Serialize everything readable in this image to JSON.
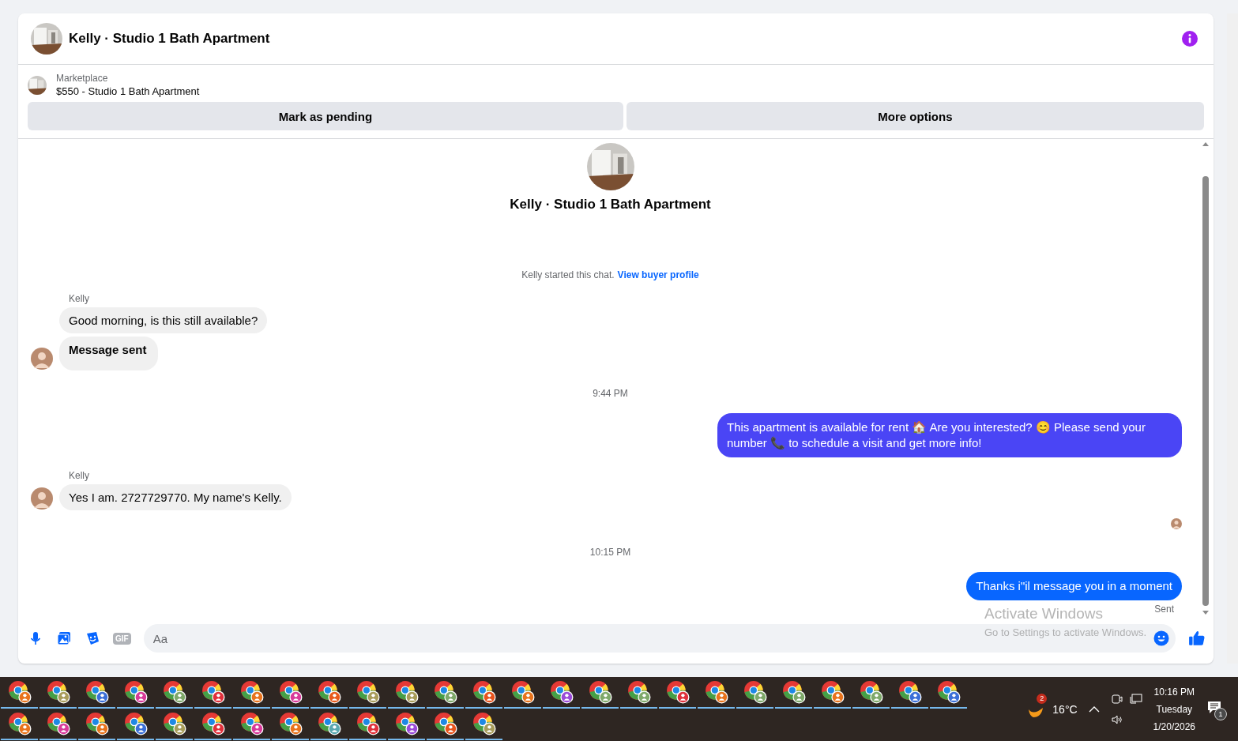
{
  "header": {
    "title": "Kelly · Studio 1 Bath Apartment"
  },
  "listing": {
    "source": "Marketplace",
    "title": "$550 - Studio 1 Bath Apartment"
  },
  "actions": [
    "Mark as pending",
    "More options"
  ],
  "intro": {
    "title": "Kelly · Studio 1 Bath Apartment",
    "started": "Kelly started this chat.",
    "link": "View buyer profile"
  },
  "thread": [
    {
      "kind": "incoming",
      "sender": "Kelly",
      "bubbles": [
        {
          "text": "Good morning, is this still available?",
          "bold": false
        },
        {
          "text": "Message sent",
          "bold": true
        }
      ]
    },
    {
      "kind": "timestamp",
      "text": "9:44 PM"
    },
    {
      "kind": "outgoing",
      "text": "This apartment is available for rent 🏠 Are you interested? 😊 Please send your number 📞 to schedule a visit and get more info!",
      "color": "#4a45f5"
    },
    {
      "kind": "incoming",
      "sender": "Kelly",
      "bubbles": [
        {
          "text": "Yes I am. 2727729770. My name's Kelly.",
          "bold": false
        }
      ]
    },
    {
      "kind": "seen"
    },
    {
      "kind": "timestamp",
      "text": "10:15 PM"
    },
    {
      "kind": "outgoing",
      "text": "Thanks i\"il message you in a moment",
      "color": "#0866ff",
      "status": "Sent"
    }
  ],
  "composer": {
    "gif_label": "GIF",
    "placeholder": "Aa"
  },
  "os_overlay": {
    "title": "Activate Windows",
    "hint": "Go to Settings to activate Windows."
  },
  "taskbar": {
    "rows": [
      [
        {
          "color": "#e8731c"
        },
        {
          "color": "#a89c5a"
        },
        {
          "color": "#3a6fd8"
        },
        {
          "color": "#d83a9a"
        },
        {
          "color": "#7ea86a"
        },
        {
          "color": "#e0303a"
        },
        {
          "color": "#e8731c"
        },
        {
          "color": "#d83a9a"
        },
        {
          "color": "#e85a1c"
        },
        {
          "color": "#a89c5a"
        },
        {
          "color": "#a89c5a"
        },
        {
          "color": "#7ea86a"
        },
        {
          "color": "#e8531c"
        },
        {
          "color": "#e8731c"
        },
        {
          "color": "#9a4ad8"
        },
        {
          "color": "#7ea86a"
        },
        {
          "color": "#7ea86a"
        },
        {
          "color": "#e0303a"
        },
        {
          "color": "#e8731c"
        },
        {
          "color": "#7ea86a"
        },
        {
          "color": "#7ea86a"
        },
        {
          "color": "#e8731c"
        },
        {
          "color": "#7ea86a"
        },
        {
          "color": "#3a6fd8"
        },
        {
          "color": "#3a6fd8"
        }
      ],
      [
        {
          "color": "#e8731c"
        },
        {
          "color": "#d83a9a"
        },
        {
          "color": "#e8731c"
        },
        {
          "color": "#3a6fd8"
        },
        {
          "color": "#a89c5a"
        },
        {
          "color": "#e0303a"
        },
        {
          "color": "#d83a9a"
        },
        {
          "color": "#e8731c"
        },
        {
          "color": "#5aa8b0"
        },
        {
          "color": "#e0303a"
        },
        {
          "color": "#9a4ad8"
        },
        {
          "color": "#e8531c"
        },
        {
          "color": "#a89c5a"
        }
      ]
    ],
    "weather_badge": "2",
    "temperature": "16°C",
    "time": "10:16 PM",
    "day": "Tuesday",
    "date": "1/20/2026",
    "notification_count": "1"
  }
}
